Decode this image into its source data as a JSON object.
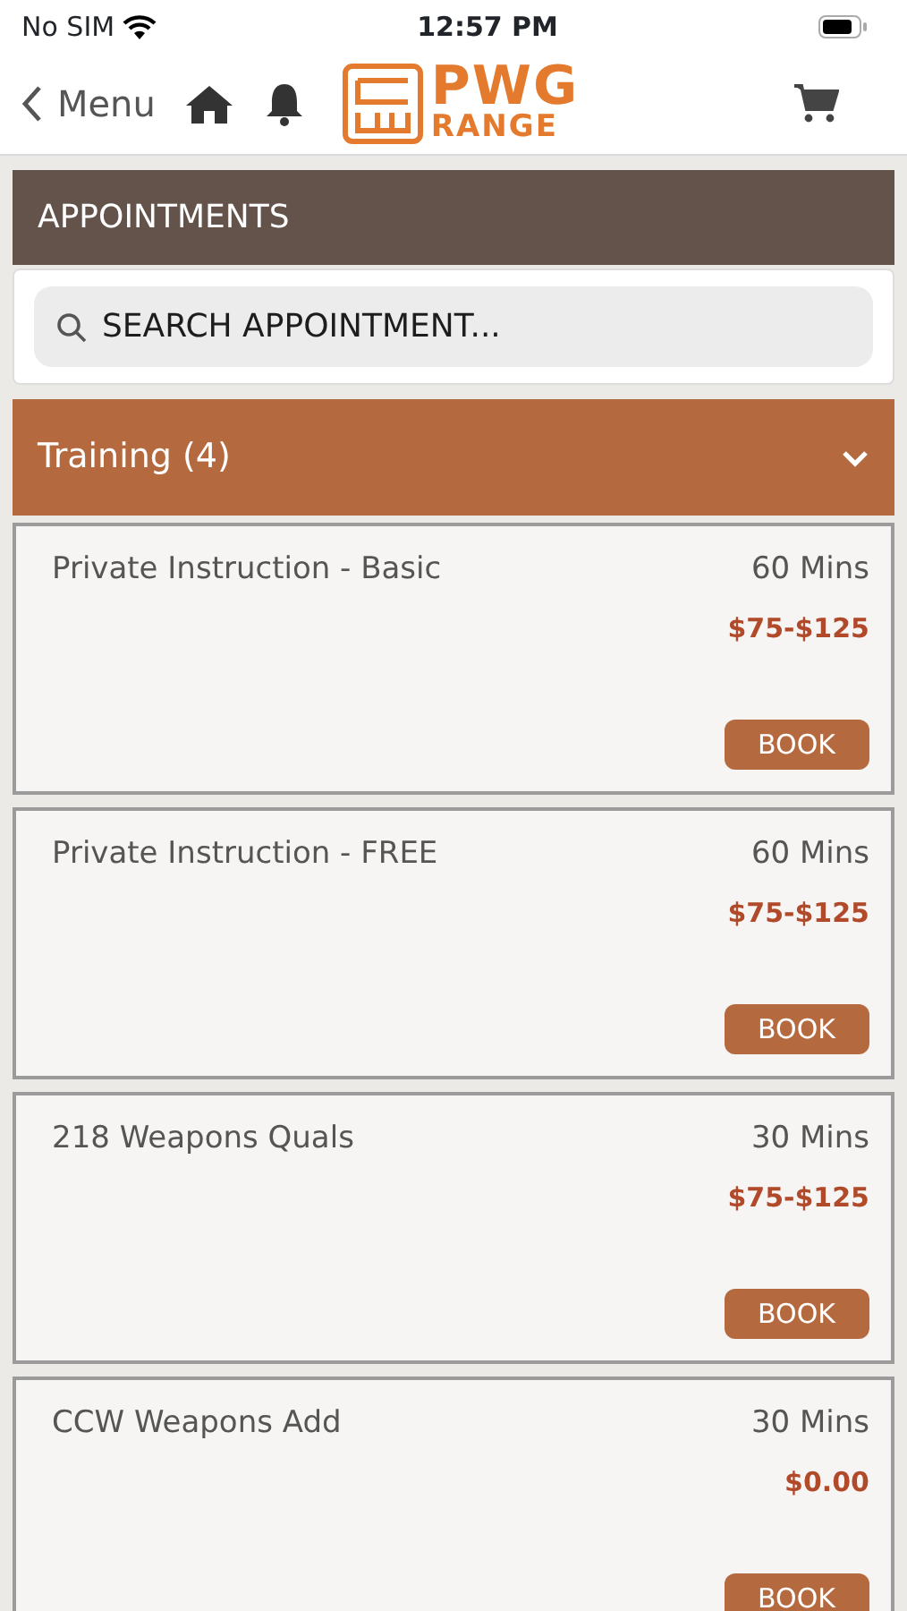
{
  "status_bar": {
    "carrier": "No SIM",
    "time": "12:57 PM"
  },
  "nav": {
    "back_label": "Menu",
    "logo": {
      "line1": "PWG",
      "line2": "RANGE"
    }
  },
  "section_title": "APPOINTMENTS",
  "search": {
    "placeholder": "SEARCH APPOINTMENT..."
  },
  "category": {
    "label": "Training (4)",
    "expanded": true
  },
  "appointments": [
    {
      "name": "Private Instruction - Basic",
      "duration": "60 Mins",
      "price": "$75-$125",
      "button": "BOOK"
    },
    {
      "name": "Private Instruction - FREE",
      "duration": "60 Mins",
      "price": "$75-$125",
      "button": "BOOK"
    },
    {
      "name": "218 Weapons Quals",
      "duration": "30 Mins",
      "price": "$75-$125",
      "button": "BOOK"
    },
    {
      "name": "CCW Weapons Add",
      "duration": "30 Mins",
      "price": "$0.00",
      "button": "BOOK"
    }
  ]
}
